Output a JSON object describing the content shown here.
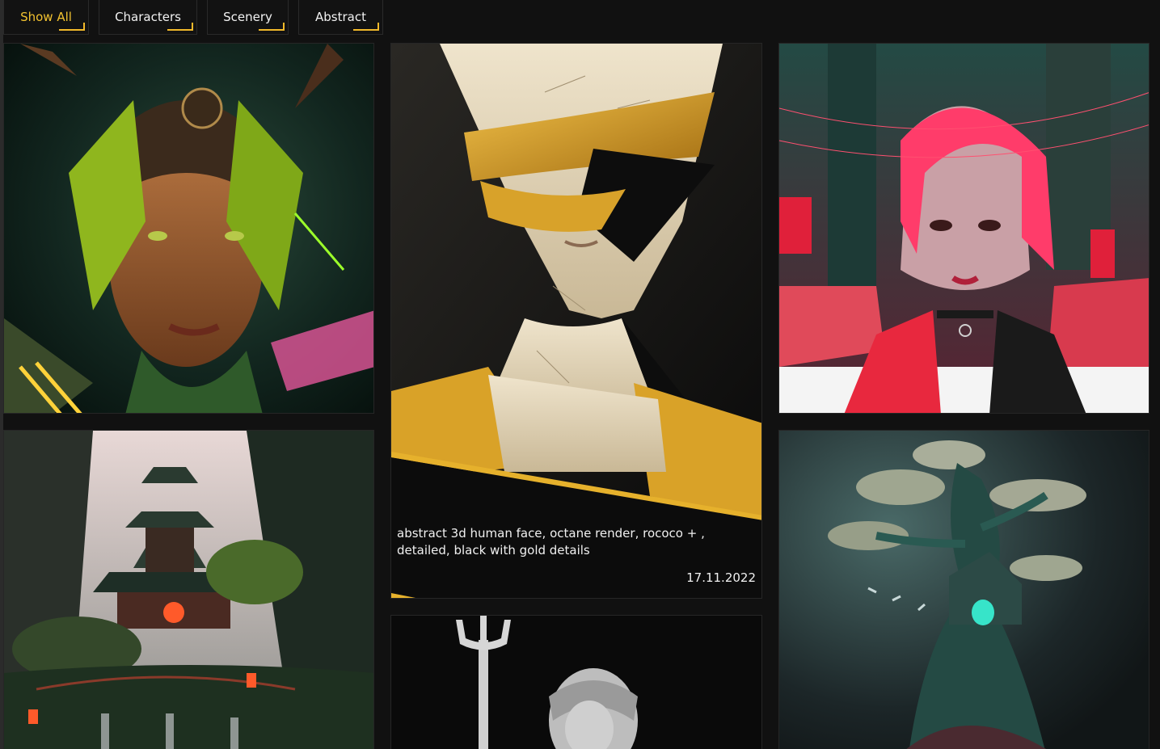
{
  "filters": [
    {
      "label": "Show All",
      "active": true
    },
    {
      "label": "Characters",
      "active": false
    },
    {
      "label": "Scenery",
      "active": false
    },
    {
      "label": "Abstract",
      "active": false
    }
  ],
  "gallery": {
    "featured": {
      "caption": "abstract 3d human face, octane render, rococo + , detailed, black with gold details",
      "date": "17.11.2022"
    }
  },
  "colors": {
    "accent": "#f2b92a",
    "background": "#111111",
    "card_border": "#262626"
  }
}
